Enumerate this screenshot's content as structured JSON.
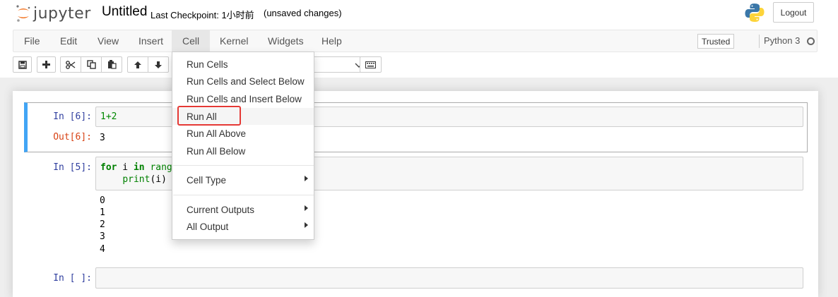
{
  "header": {
    "logo_text": "jupyter",
    "notebook_title": "Untitled",
    "checkpoint": "Last Checkpoint: 1小时前",
    "unsaved": "(unsaved changes)",
    "logout_label": "Logout"
  },
  "menubar": {
    "items": [
      "File",
      "Edit",
      "View",
      "Insert",
      "Cell",
      "Kernel",
      "Widgets",
      "Help"
    ],
    "active": "Cell",
    "trusted_label": "Trusted",
    "kernel_name": "Python 3"
  },
  "toolbar": {
    "buttons": [
      "save-icon",
      "plus-icon",
      "cut-icon",
      "copy-icon",
      "paste-icon",
      "arrow-up-icon",
      "arrow-down-icon"
    ],
    "keyboard_icon": "keyboard-icon"
  },
  "cells": [
    {
      "prompt_in": "In [6]:",
      "code": "1+2",
      "prompt_out": "Out[6]:",
      "output": "3"
    },
    {
      "prompt_in": "In [5]:",
      "code_line1_kw": "for",
      "code_line1_var": " i ",
      "code_line1_in": "in",
      "code_line1_rest": " range",
      "code_line2_fn": "print",
      "code_line2_rest": "(i)",
      "output": [
        "0",
        "1",
        "2",
        "3",
        "4"
      ]
    },
    {
      "prompt_in": "In [ ]:"
    }
  ],
  "cell_menu": {
    "items": [
      {
        "label": "Run Cells"
      },
      {
        "label": "Run Cells and Select Below"
      },
      {
        "label": "Run Cells and Insert Below"
      },
      {
        "label": "Run All",
        "highlighted": true
      },
      {
        "label": "Run All Above"
      },
      {
        "label": "Run All Below"
      },
      {
        "label": "Cell Type",
        "submenu": true
      },
      {
        "label": "Current Outputs",
        "submenu": true
      },
      {
        "label": "All Output",
        "submenu": true
      }
    ]
  },
  "colors": {
    "selected_cell_border": "#42a5f5",
    "highlight_box": "#e53935",
    "in_prompt": "#303f9f",
    "out_prompt": "#d84315"
  }
}
